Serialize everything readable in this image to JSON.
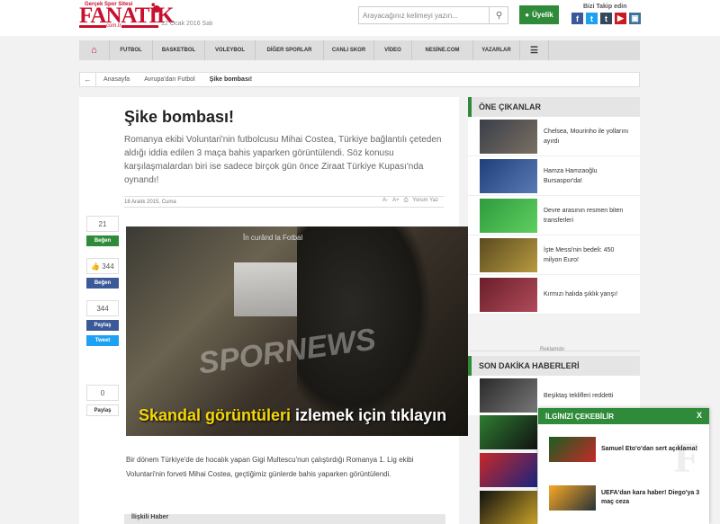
{
  "header": {
    "tagline": "Gerçek Spor Sitesi",
    "logo": "FANATİK",
    "logo_sub": "com.tr",
    "date": "12 Ocak 2016 Salı",
    "search_placeholder": "Arayacağınız kelimeyi yazın...",
    "login_label": "Üyelik",
    "follow_label": "Bizi Takip edin",
    "socials": [
      "facebook-icon",
      "twitter-icon",
      "tumblr-icon",
      "youtube-icon",
      "instagram-icon"
    ],
    "colors": {
      "brand_red": "#c8102e",
      "green": "#2f8b3a"
    }
  },
  "nav": {
    "items": [
      "FUTBOL",
      "BASKETBOL",
      "VOLEYBOL",
      "DİĞER SPORLAR",
      "CANLI SKOR",
      "VİDEO",
      "NESİNE.COM",
      "YAZARLAR"
    ]
  },
  "breadcrumb": [
    "Anasayfa",
    "Avrupa'dan Futbol",
    "Şike bombası!"
  ],
  "article": {
    "title": "Şike bombası!",
    "lead": "Romanya ekibi Voluntari'nin futbolcusu Mihai Costea, Türkiye bağlantılı çeteden aldığı iddia edilen 3 maça bahis yaparken görüntülendi. Söz konusu karşılaşmalardan biri ise sadece birçok gün önce Ziraat Türkiye Kupası'nda oynandı!",
    "date": "18 Aralık 2015, Cuma",
    "font_minus": "A-",
    "font_plus": "A+",
    "comment_label": "Yorum Yaz",
    "image_watermark": "SPORNEWS",
    "image_caption_yellow": "Skandal görüntüleri",
    "image_caption_white": "izlemek için tıklayın",
    "image_topnote": "În curând la Fotbal",
    "body": "Bir dönem Türkiye'de de hocalık yapan Gigi Multescu'nun çalıştırdığı Romanya 1. Lig ekibi Voluntari'nin forveti Mihai Costea, geçtiğimiz günlerde bahis yaparken görüntülendi.",
    "related_label": "İlişkili Haber"
  },
  "share": {
    "fb_count": "21",
    "fb_like_label": "Beğen",
    "like_count": "344",
    "like_label": "Beğen",
    "share_count": "344",
    "share_label": "Paylaş",
    "tweet_label": "Tweet",
    "gplus_count": "0",
    "gplus_label": "Paylaş"
  },
  "featured": {
    "title": "ÖNE ÇIKANLAR",
    "items": [
      "Chelsea, Mourinho ile yollarını ayırdı",
      "Hamza Hamzaoğlu Bursaspor'da!",
      "Devre arasının resmen biten transferleri",
      "İşte Messi'nin bedeli: 450 milyon Euro!",
      "Kırmızı halıda şıklık yarışı!"
    ]
  },
  "ad_label": "Reklamdır",
  "breaking": {
    "title": "SON DAKİKA HABERLERİ",
    "items": [
      "Beşiktaş teklifleri reddetti"
    ]
  },
  "popup": {
    "title": "İLGİNİZİ ÇEKEBİLİR",
    "close": "X",
    "items": [
      "Samuel Eto'o'dan sert açıklama!",
      "UEFA'dan kara haber! Diego'ya 3 maç ceza"
    ]
  }
}
